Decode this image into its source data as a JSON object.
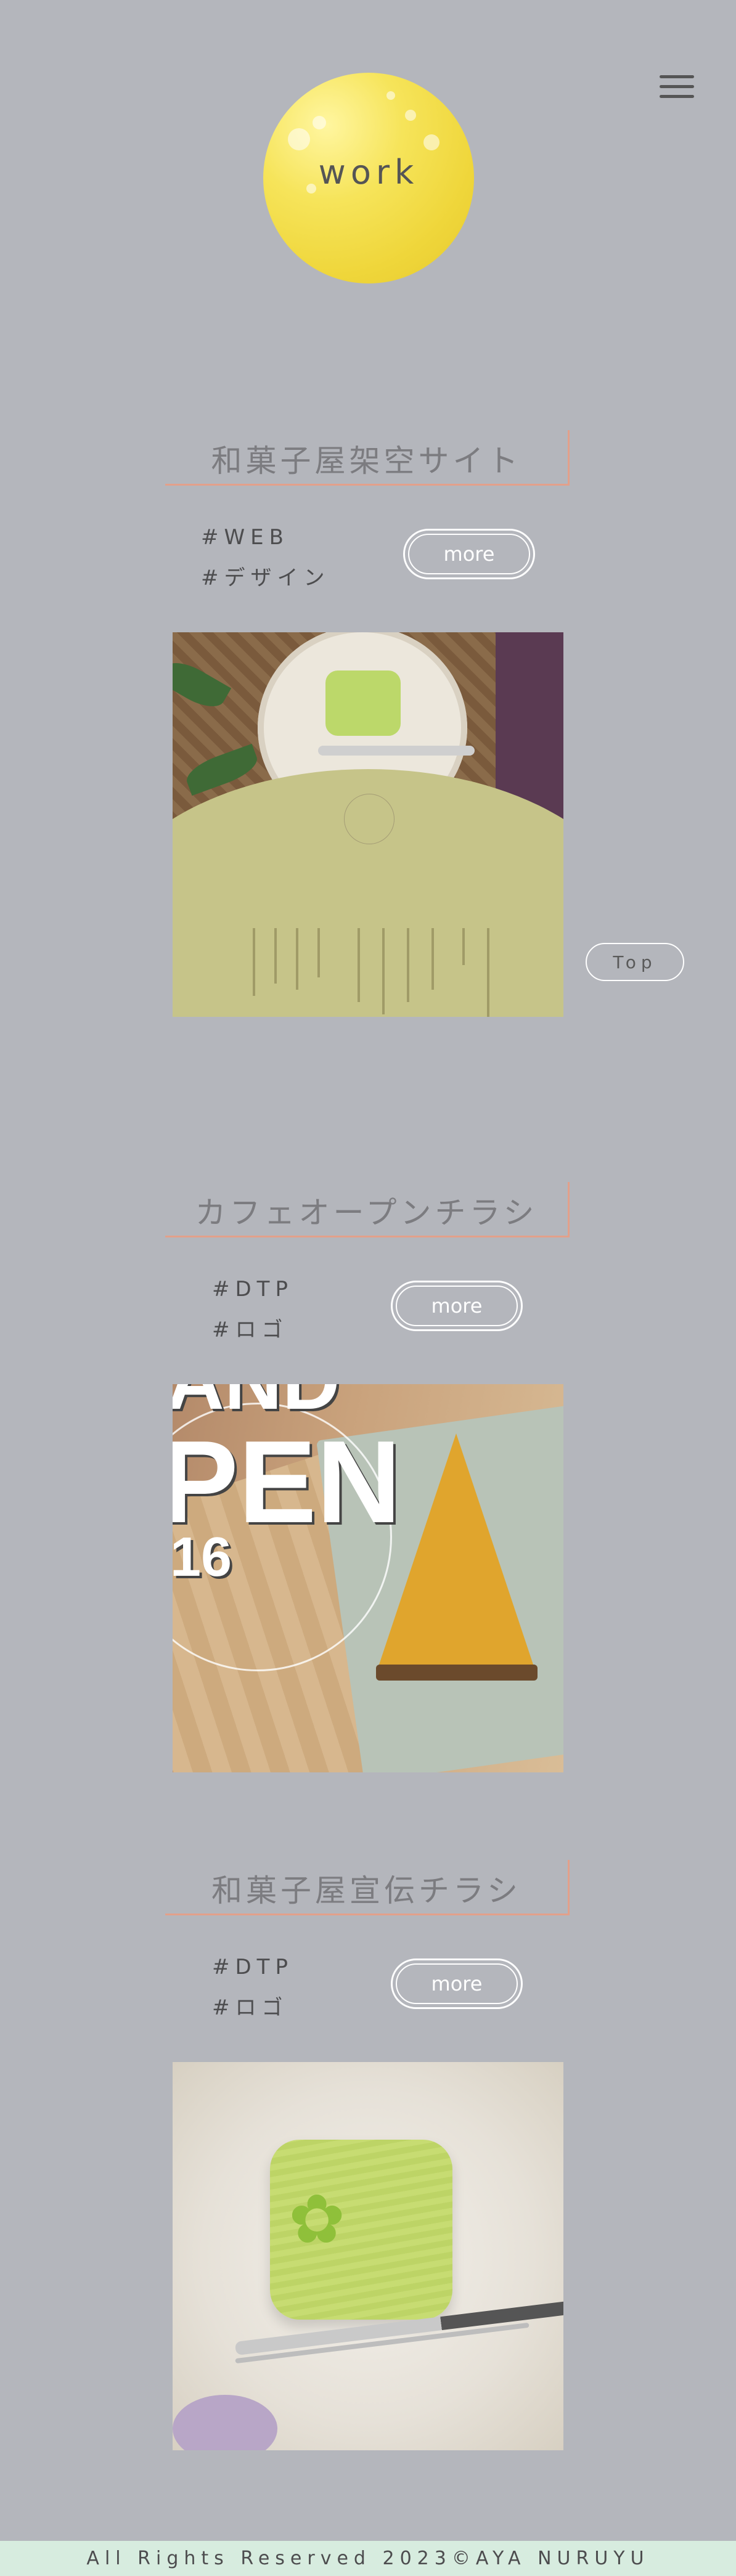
{
  "header": {
    "logo_text": "work",
    "menu_icon": "hamburger-menu-icon"
  },
  "works": [
    {
      "title": "和菓子屋架空サイト",
      "tags": [
        "#WEB",
        "#デザイン"
      ],
      "more_label": "more"
    },
    {
      "title": "カフェオープンチラシ",
      "tags": [
        "#DTP",
        "#ロゴ"
      ],
      "more_label": "more",
      "image_text": [
        "AND",
        "PEN",
        "16"
      ]
    },
    {
      "title": "和菓子屋宣伝チラシ",
      "tags": [
        "#DTP",
        "#ロゴ"
      ],
      "more_label": "more"
    }
  ],
  "top_button": {
    "label": "Top"
  },
  "footer": {
    "copyright": "All Rights Reserved 2023©AYA NURUYU"
  },
  "colors": {
    "background": "#b4b6bc",
    "accent_border": "#e3a08a",
    "footer_bg": "#d7ecdf",
    "logo_yellow": "#efd63a"
  }
}
